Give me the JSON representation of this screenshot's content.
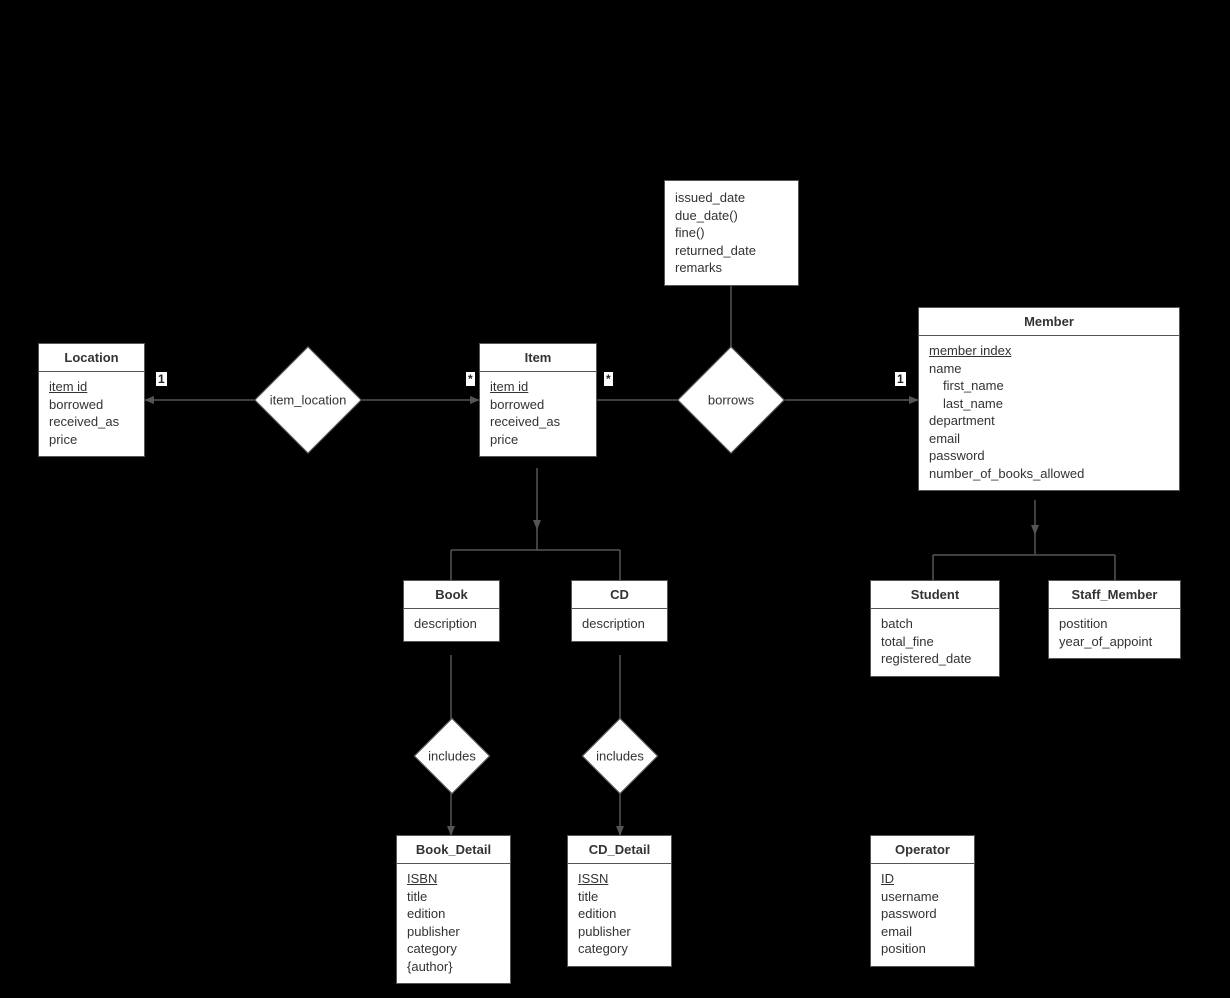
{
  "entities": {
    "location": {
      "title": "Location",
      "attrs": [
        {
          "text": "item id",
          "underline": true
        },
        {
          "text": "borrowed"
        },
        {
          "text": "received_as"
        },
        {
          "text": "price"
        }
      ]
    },
    "item": {
      "title": "Item",
      "attrs": [
        {
          "text": "item id",
          "underline": true
        },
        {
          "text": "borrowed"
        },
        {
          "text": "received_as"
        },
        {
          "text": "price"
        }
      ]
    },
    "member": {
      "title": "Member",
      "attrs": [
        {
          "text": "member index",
          "underline": true
        },
        {
          "text": "name"
        },
        {
          "text": "first_name",
          "indent": true
        },
        {
          "text": "last_name",
          "indent": true
        },
        {
          "text": "department"
        },
        {
          "text": "email"
        },
        {
          "text": "password"
        },
        {
          "text": "number_of_books_allowed"
        }
      ]
    },
    "book": {
      "title": "Book",
      "attrs": [
        {
          "text": "description"
        }
      ]
    },
    "cd": {
      "title": "CD",
      "attrs": [
        {
          "text": "description"
        }
      ]
    },
    "student": {
      "title": "Student",
      "attrs": [
        {
          "text": "batch"
        },
        {
          "text": "total_fine"
        },
        {
          "text": "registered_date"
        }
      ]
    },
    "staff_member": {
      "title": "Staff_Member",
      "attrs": [
        {
          "text": "postition"
        },
        {
          "text": "year_of_appoint"
        }
      ]
    },
    "book_detail": {
      "title": "Book_Detail",
      "attrs": [
        {
          "text": "ISBN",
          "underline": true
        },
        {
          "text": "title"
        },
        {
          "text": "edition"
        },
        {
          "text": "publisher"
        },
        {
          "text": "category"
        },
        {
          "text": "{author}"
        }
      ]
    },
    "cd_detail": {
      "title": "CD_Detail",
      "attrs": [
        {
          "text": "ISSN",
          "underline": true
        },
        {
          "text": "title"
        },
        {
          "text": "edition"
        },
        {
          "text": "publisher"
        },
        {
          "text": "category"
        }
      ]
    },
    "operator": {
      "title": "Operator",
      "attrs": [
        {
          "text": "ID",
          "underline": true
        },
        {
          "text": "username"
        },
        {
          "text": "password"
        },
        {
          "text": "email"
        },
        {
          "text": "position"
        }
      ]
    },
    "borrows_attrs": {
      "attrs": [
        {
          "text": "issued_date"
        },
        {
          "text": "due_date()"
        },
        {
          "text": "fine()"
        },
        {
          "text": "returned_date"
        },
        {
          "text": "remarks"
        }
      ]
    }
  },
  "relationships": {
    "item_location": "item_location",
    "borrows": "borrows",
    "includes_book": "includes",
    "includes_cd": "includes"
  },
  "cardinalities": {
    "loc_one": "1",
    "item_star_left": "*",
    "item_star_right": "*",
    "member_one": "1"
  }
}
